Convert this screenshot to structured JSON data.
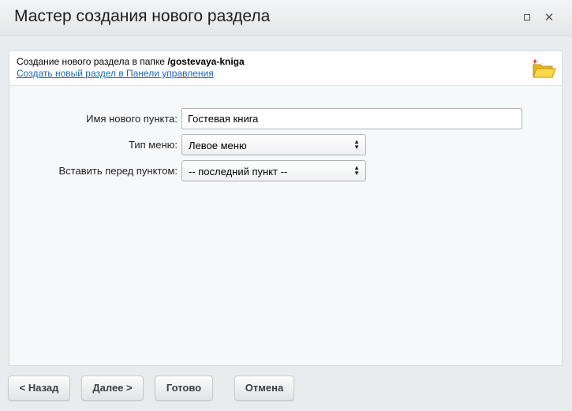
{
  "window": {
    "title": "Мастер создания нового раздела"
  },
  "header": {
    "line1_prefix": "Создание нового раздела в папке ",
    "line1_path": "/gostevaya-kniga",
    "link": "Создать новый раздел в Панели управления"
  },
  "form": {
    "name_label": "Имя нового пункта:",
    "name_value": "Гостевая книга",
    "menu_type_label": "Тип меню:",
    "menu_type_value": "Левое меню",
    "insert_before_label": "Вставить перед пунктом:",
    "insert_before_value": "-- последний пункт --"
  },
  "buttons": {
    "back": "< Назад",
    "next": "Далее >",
    "done": "Готово",
    "cancel": "Отмена"
  }
}
